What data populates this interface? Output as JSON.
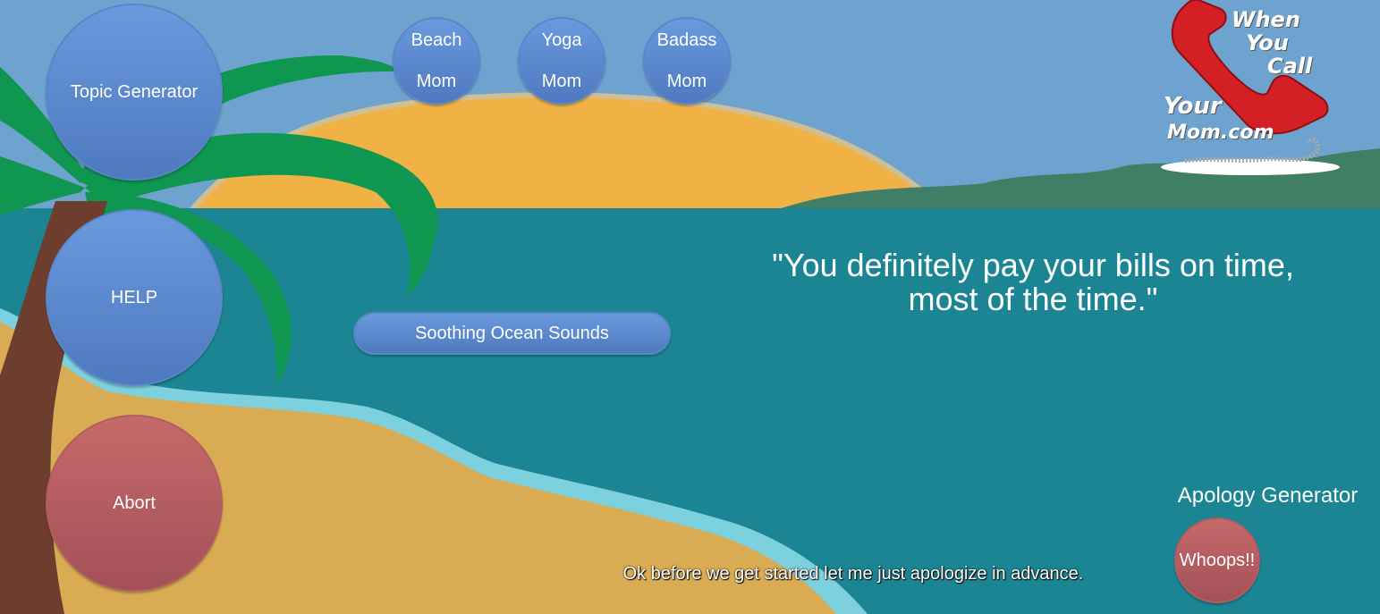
{
  "buttons": {
    "topic_generator": "Topic Generator",
    "help": "HELP",
    "abort": "Abort",
    "soothing_ocean_sounds": "Soothing Ocean Sounds"
  },
  "mom_buttons": [
    {
      "line1": "Beach",
      "line2": "Mom"
    },
    {
      "line1": "Yoga",
      "line2": "Mom"
    },
    {
      "line1": "Badass",
      "line2": "Mom"
    }
  ],
  "logo": {
    "line1": "When",
    "line2": "You",
    "line3": "Call",
    "line4": "Your",
    "line5": "Mom.com"
  },
  "quote": "\"You definitely pay your bills on time, most of the time.\"",
  "apology": {
    "title": "Apology Generator",
    "button": "Whoops!!"
  },
  "subtitle": "Ok before we get started let me just apologize in advance.",
  "colors": {
    "sky": "#6fa3cf",
    "sun": "#f0b245",
    "ocean": "#1b8594",
    "sand": "#d9ab52",
    "foam": "#7dd0dd",
    "palm_leaf": "#0f9650",
    "trunk": "#6d3e2e",
    "hills": "#3f7f66",
    "button_blue": "#5f8bd2",
    "button_red": "#b65c62"
  }
}
